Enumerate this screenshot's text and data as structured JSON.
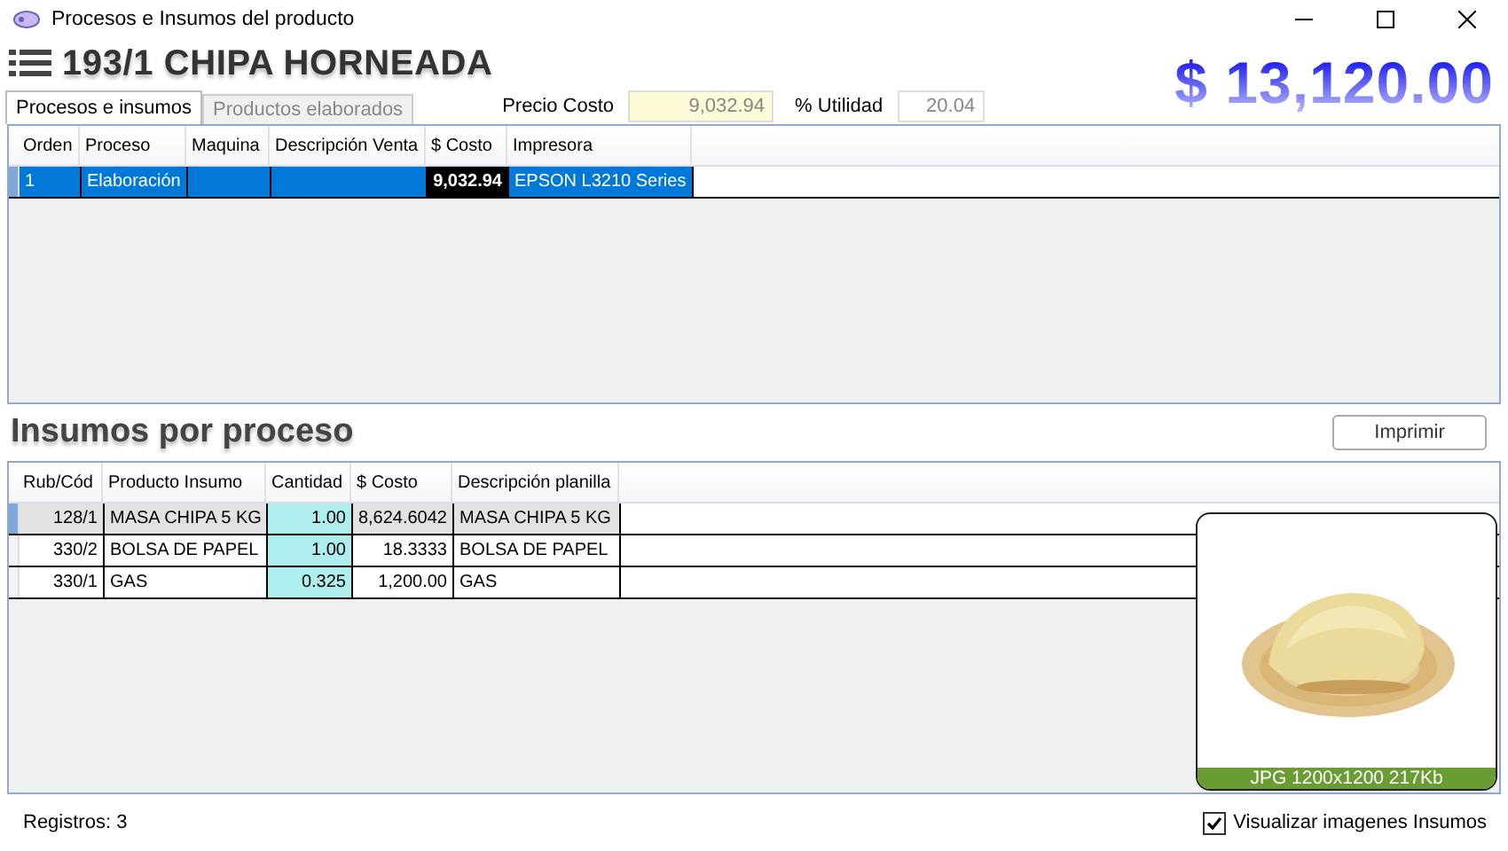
{
  "window": {
    "title": "Procesos e Insumos del producto"
  },
  "product": {
    "title": "193/1 CHIPA HORNEADA",
    "price": "$ 13,120.00"
  },
  "tabs": [
    {
      "label": "Procesos e insumos",
      "selected": true
    },
    {
      "label": "Productos elaborados",
      "selected": false
    }
  ],
  "fields": [
    {
      "label": "Precio Costo",
      "value": "9,032.94",
      "kind": "cost"
    },
    {
      "label": "% Utilidad",
      "value": "20.04",
      "kind": "plain"
    }
  ],
  "processes": {
    "columns": [
      {
        "label": "Orden",
        "kind": "text"
      },
      {
        "label": "Proceso",
        "kind": "text"
      },
      {
        "label": "Maquina",
        "kind": "text"
      },
      {
        "label": "Descripción Venta",
        "kind": "text"
      },
      {
        "label": "$ Costo",
        "kind": "number"
      },
      {
        "label": "Impresora",
        "kind": "text"
      }
    ],
    "rows": [
      {
        "selected": true,
        "cells": [
          "1",
          "Elaboración",
          null,
          null,
          {
            "text": "9,032.94",
            "focused": true
          },
          "EPSON L3210 Series"
        ]
      }
    ]
  },
  "supplies": {
    "title": "Insumos por proceso",
    "print_button": "Imprimir",
    "columns": [
      {
        "label": "Rub/Cód",
        "kind": "number"
      },
      {
        "label": "Producto Insumo",
        "kind": "text"
      },
      {
        "label": "Cantidad",
        "kind": "input"
      },
      {
        "label": "$ Costo",
        "kind": "number"
      },
      {
        "label": "Descripción planilla",
        "kind": "text"
      }
    ],
    "rows": [
      {
        "selected": true,
        "cells": [
          "128/1",
          "MASA CHIPA 5 KG",
          "1.00",
          "8,624.6042",
          "MASA CHIPA 5 KG"
        ]
      },
      {
        "selected": false,
        "cells": [
          "330/2",
          "BOLSA DE PAPEL",
          "1.00",
          "18.3333",
          "BOLSA DE PAPEL"
        ]
      },
      {
        "selected": false,
        "cells": [
          "330/1",
          "GAS",
          "0.325",
          "1,200.00",
          "GAS"
        ]
      }
    ],
    "image": {
      "kind": "picture",
      "caption": "JPG 1200x1200 217Kb"
    }
  },
  "status_bar": {
    "records": "Registros: 3",
    "show_images": {
      "label": "Visualizar imagenes Insumos",
      "checked": true
    }
  }
}
